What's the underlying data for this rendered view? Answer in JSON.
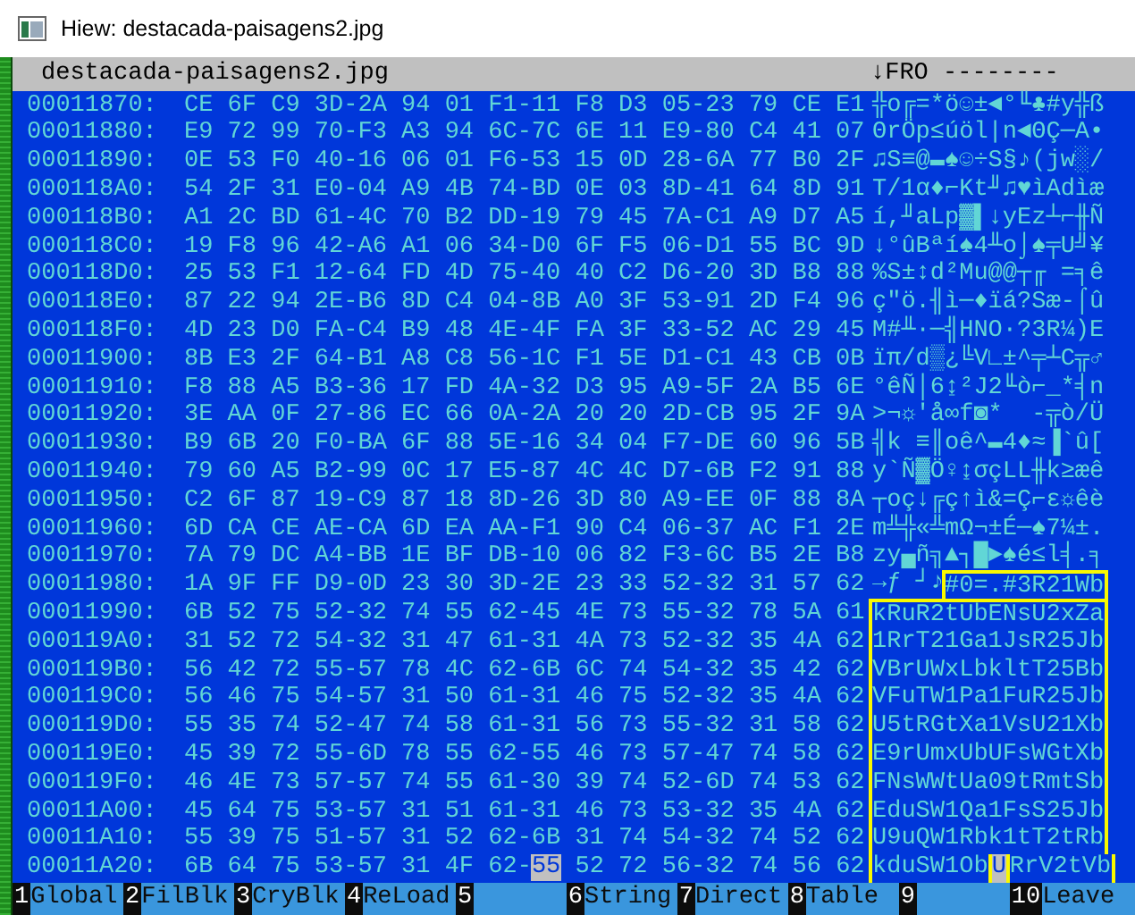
{
  "window": {
    "title": "Hiew: destacada-paisagens2.jpg"
  },
  "header": {
    "file_name": "destacada-paisagens2.jpg",
    "mode": "↓FRO --------"
  },
  "rows": [
    {
      "address": "00011870:",
      "hex": [
        {
          "text": "CE 6F C9 3D-2A 94 01 F1-11 F8 D3 05-23 79 CE E1",
          "cursor": false
        }
      ],
      "ascii": [
        {
          "text": "╬o╔=*ö☺±◄°╙♣#y╬ß",
          "selected": false,
          "cursor": false
        }
      ]
    },
    {
      "address": "00011880:",
      "hex": [
        {
          "text": "E9 72 99 70-F3 A3 94 6C-7C 6E 11 E9-80 C4 41 07",
          "cursor": false
        }
      ],
      "ascii": [
        {
          "text": "ΘrÖp≤úöl|n◄ΘÇ─A•",
          "selected": false,
          "cursor": false
        }
      ]
    },
    {
      "address": "00011890:",
      "hex": [
        {
          "text": "0E 53 F0 40-16 06 01 F6-53 15 0D 28-6A 77 B0 2F",
          "cursor": false
        }
      ],
      "ascii": [
        {
          "text": "♫S≡@▬♠☺÷S§♪(jw░/",
          "selected": false,
          "cursor": false
        }
      ]
    },
    {
      "address": "000118A0:",
      "hex": [
        {
          "text": "54 2F 31 E0-04 A9 4B 74-BD 0E 03 8D-41 64 8D 91",
          "cursor": false
        }
      ],
      "ascii": [
        {
          "text": "T/1α♦⌐Kt╜♫♥ìAdìæ",
          "selected": false,
          "cursor": false
        }
      ]
    },
    {
      "address": "000118B0:",
      "hex": [
        {
          "text": "A1 2C BD 61-4C 70 B2 DD-19 79 45 7A-C1 A9 D7 A5",
          "cursor": false
        }
      ],
      "ascii": [
        {
          "text": "í,╜aLp▓▌↓yEz┴⌐╫Ñ",
          "selected": false,
          "cursor": false
        }
      ]
    },
    {
      "address": "000118C0:",
      "hex": [
        {
          "text": "19 F8 96 42-A6 A1 06 34-D0 6F F5 06-D1 55 BC 9D",
          "cursor": false
        }
      ],
      "ascii": [
        {
          "text": "↓°ûBªí♠4╨o⌡♠╤U╝¥",
          "selected": false,
          "cursor": false
        }
      ]
    },
    {
      "address": "000118D0:",
      "hex": [
        {
          "text": "25 53 F1 12-64 FD 4D 75-40 40 C2 D6-20 3D B8 88",
          "cursor": false
        }
      ],
      "ascii": [
        {
          "text": "%S±↕d²Mu@@┬╓ =╕ê",
          "selected": false,
          "cursor": false
        }
      ]
    },
    {
      "address": "000118E0:",
      "hex": [
        {
          "text": "87 22 94 2E-B6 8D C4 04-8B A0 3F 53-91 2D F4 96",
          "cursor": false
        }
      ],
      "ascii": [
        {
          "text": "ç\"ö.╢ì─♦ïá?Sæ-⌠û",
          "selected": false,
          "cursor": false
        }
      ]
    },
    {
      "address": "000118F0:",
      "hex": [
        {
          "text": "4D 23 D0 FA-C4 B9 48 4E-4F FA 3F 33-52 AC 29 45",
          "cursor": false
        }
      ],
      "ascii": [
        {
          "text": "M#╨·─╣HNO·?3R¼)E",
          "selected": false,
          "cursor": false
        }
      ]
    },
    {
      "address": "00011900:",
      "hex": [
        {
          "text": "8B E3 2F 64-B1 A8 C8 56-1C F1 5E D1-C1 43 CB 0B",
          "cursor": false
        }
      ],
      "ascii": [
        {
          "text": "ïπ/d▒¿╚V∟±^╤┴C╦♂",
          "selected": false,
          "cursor": false
        }
      ]
    },
    {
      "address": "00011910:",
      "hex": [
        {
          "text": "F8 88 A5 B3-36 17 FD 4A-32 D3 95 A9-5F 2A B5 6E",
          "cursor": false
        }
      ],
      "ascii": [
        {
          "text": "°êÑ│6↨²J2╙ò⌐_*╡n",
          "selected": false,
          "cursor": false
        }
      ]
    },
    {
      "address": "00011920:",
      "hex": [
        {
          "text": "3E AA 0F 27-86 EC 66 0A-2A 20 20 2D-CB 95 2F 9A",
          "cursor": false
        }
      ],
      "ascii": [
        {
          "text": ">¬☼'å∞f◙*  -╦ò/Ü",
          "selected": false,
          "cursor": false
        }
      ]
    },
    {
      "address": "00011930:",
      "hex": [
        {
          "text": "B9 6B 20 F0-BA 6F 88 5E-16 34 04 F7-DE 60 96 5B",
          "cursor": false
        }
      ],
      "ascii": [
        {
          "text": "╣k ≡║oê^▬4♦≈▐`û[",
          "selected": false,
          "cursor": false
        }
      ]
    },
    {
      "address": "00011940:",
      "hex": [
        {
          "text": "79 60 A5 B2-99 0C 17 E5-87 4C 4C D7-6B F2 91 88",
          "cursor": false
        }
      ],
      "ascii": [
        {
          "text": "y`Ñ▓Ö♀↨σçLL╫k≥æê",
          "selected": false,
          "cursor": false
        }
      ]
    },
    {
      "address": "00011950:",
      "hex": [
        {
          "text": "C2 6F 87 19-C9 87 18 8D-26 3D 80 A9-EE 0F 88 8A",
          "cursor": false
        }
      ],
      "ascii": [
        {
          "text": "┬oç↓╔ç↑ì&=Ç⌐ε☼êè",
          "selected": false,
          "cursor": false
        }
      ]
    },
    {
      "address": "00011960:",
      "hex": [
        {
          "text": "6D CA CE AE-CA 6D EA AA-F1 90 C4 06-37 AC F1 2E",
          "cursor": false
        }
      ],
      "ascii": [
        {
          "text": "m╩╬«╩mΩ¬±É─♠7¼±.",
          "selected": false,
          "cursor": false
        }
      ]
    },
    {
      "address": "00011970:",
      "hex": [
        {
          "text": "7A 79 DC A4-BB 1E BF DB-10 06 82 F3-6C B5 2E B8",
          "cursor": false
        }
      ],
      "ascii": [
        {
          "text": "zy▄ñ╗▲┐█►♠é≤l╡.╕",
          "selected": false,
          "cursor": false
        }
      ]
    },
    {
      "address": "00011980:",
      "hex": [
        {
          "text": "1A 9F FF D9-0D 23 30 3D-2E 23 33 52-32 31 57 62",
          "cursor": false
        }
      ],
      "ascii": [
        {
          "text": "→ƒ ┘♪",
          "selected": false,
          "cursor": false
        },
        {
          "text": "#0=.#3R21Wb",
          "selected": true,
          "cursor": false
        }
      ]
    },
    {
      "address": "00011990:",
      "hex": [
        {
          "text": "6B 52 75 52-32 74 55 62-45 4E 73 55-32 78 5A 61",
          "cursor": false
        }
      ],
      "ascii": [
        {
          "text": "kRuR2tUbENsU2xZa",
          "selected": true,
          "cursor": false
        }
      ]
    },
    {
      "address": "000119A0:",
      "hex": [
        {
          "text": "31 52 72 54-32 31 47 61-31 4A 73 52-32 35 4A 62",
          "cursor": false
        }
      ],
      "ascii": [
        {
          "text": "1RrT21Ga1JsR25Jb",
          "selected": true,
          "cursor": false
        }
      ]
    },
    {
      "address": "000119B0:",
      "hex": [
        {
          "text": "56 42 72 55-57 78 4C 62-6B 6C 74 54-32 35 42 62",
          "cursor": false
        }
      ],
      "ascii": [
        {
          "text": "VBrUWxLbkltT25Bb",
          "selected": true,
          "cursor": false
        }
      ]
    },
    {
      "address": "000119C0:",
      "hex": [
        {
          "text": "56 46 75 54-57 31 50 61-31 46 75 52-32 35 4A 62",
          "cursor": false
        }
      ],
      "ascii": [
        {
          "text": "VFuTW1Pa1FuR25Jb",
          "selected": true,
          "cursor": false
        }
      ]
    },
    {
      "address": "000119D0:",
      "hex": [
        {
          "text": "55 35 74 52-47 74 58 61-31 56 73 55-32 31 58 62",
          "cursor": false
        }
      ],
      "ascii": [
        {
          "text": "U5tRGtXa1VsU21Xb",
          "selected": true,
          "cursor": false
        }
      ]
    },
    {
      "address": "000119E0:",
      "hex": [
        {
          "text": "45 39 72 55-6D 78 55 62-55 46 73 57-47 74 58 62",
          "cursor": false
        }
      ],
      "ascii": [
        {
          "text": "E9rUmxUbUFsWGtXb",
          "selected": true,
          "cursor": false
        }
      ]
    },
    {
      "address": "000119F0:",
      "hex": [
        {
          "text": "46 4E 73 57-57 74 55 61-30 39 74 52-6D 74 53 62",
          "cursor": false
        }
      ],
      "ascii": [
        {
          "text": "FNsWWtUa09tRmtSb",
          "selected": true,
          "cursor": false
        }
      ]
    },
    {
      "address": "00011A00:",
      "hex": [
        {
          "text": "45 64 75 53-57 31 51 61-31 46 73 53-32 35 4A 62",
          "cursor": false
        }
      ],
      "ascii": [
        {
          "text": "EduSW1Qa1FsS25Jb",
          "selected": true,
          "cursor": false
        }
      ]
    },
    {
      "address": "00011A10:",
      "hex": [
        {
          "text": "55 39 75 51-57 31 52 62-6B 31 74 54-32 74 52 62",
          "cursor": false
        }
      ],
      "ascii": [
        {
          "text": "U9uQW1Rbk1tT2tRb",
          "selected": true,
          "cursor": false
        }
      ]
    },
    {
      "address": "00011A20:",
      "hex": [
        {
          "text": "6B 64 75 53-57 31 4F 62-",
          "cursor": false
        },
        {
          "text": "55",
          "cursor": true
        },
        {
          "text": " 52 72 56-32 74 56 62",
          "cursor": false
        }
      ],
      "ascii": [
        {
          "text": "kduSW1Ob",
          "selected": true,
          "cursor": false
        },
        {
          "text": "U",
          "selected": true,
          "cursor": true
        },
        {
          "text": "RrV2tVb",
          "selected": true,
          "cursor": false
        }
      ]
    }
  ],
  "function_keys": [
    {
      "number": "1",
      "label": "Global"
    },
    {
      "number": "2",
      "label": "FilBlk"
    },
    {
      "number": "3",
      "label": "CryBlk"
    },
    {
      "number": "4",
      "label": "ReLoad"
    },
    {
      "number": "5"
    },
    {
      "number": "6",
      "label": "String"
    },
    {
      "number": "7",
      "label": "Direct"
    },
    {
      "number": "8",
      "label": "Table"
    },
    {
      "number": "9"
    },
    {
      "number": "10",
      "label": "Leave"
    }
  ]
}
